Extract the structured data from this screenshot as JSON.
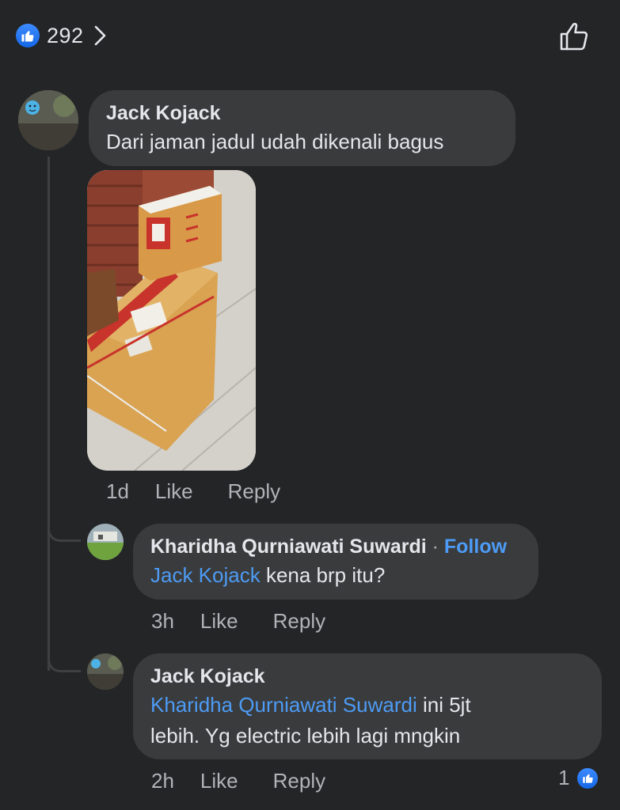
{
  "reactions": {
    "count": "292",
    "like_badge_icon": "thumbs-up-icon",
    "chevron_icon": "chevron-right-icon",
    "like_button_icon": "thumbs-up-outline-icon"
  },
  "comments": [
    {
      "author": "Jack Kojack",
      "text": "Dari jaman jadul udah dikenali bagus",
      "has_photo": true,
      "time": "1d",
      "like_label": "Like",
      "reply_label": "Reply"
    }
  ],
  "replies": [
    {
      "author": "Kharidha Qurniawati Suwardi",
      "separator": " · ",
      "follow_label": "Follow",
      "mention": "Jack Kojack",
      "text": " kena brp itu?",
      "time": "3h",
      "like_label": "Like",
      "reply_label": "Reply"
    },
    {
      "author": "Jack Kojack",
      "mention": "Kharidha Qurniawati Suwardi",
      "text_line1_rest": " ini 5jt",
      "text_line2": "lebih. Yg electric lebih lagi mngkin",
      "time": "2h",
      "like_label": "Like",
      "reply_label": "Reply",
      "reaction_count": "1"
    }
  ],
  "colors": {
    "background": "#242526",
    "bubble": "#3a3b3c",
    "link": "#4d9bf5",
    "secondary_text": "#b0b3b8",
    "like_blue": "#1877f2"
  }
}
